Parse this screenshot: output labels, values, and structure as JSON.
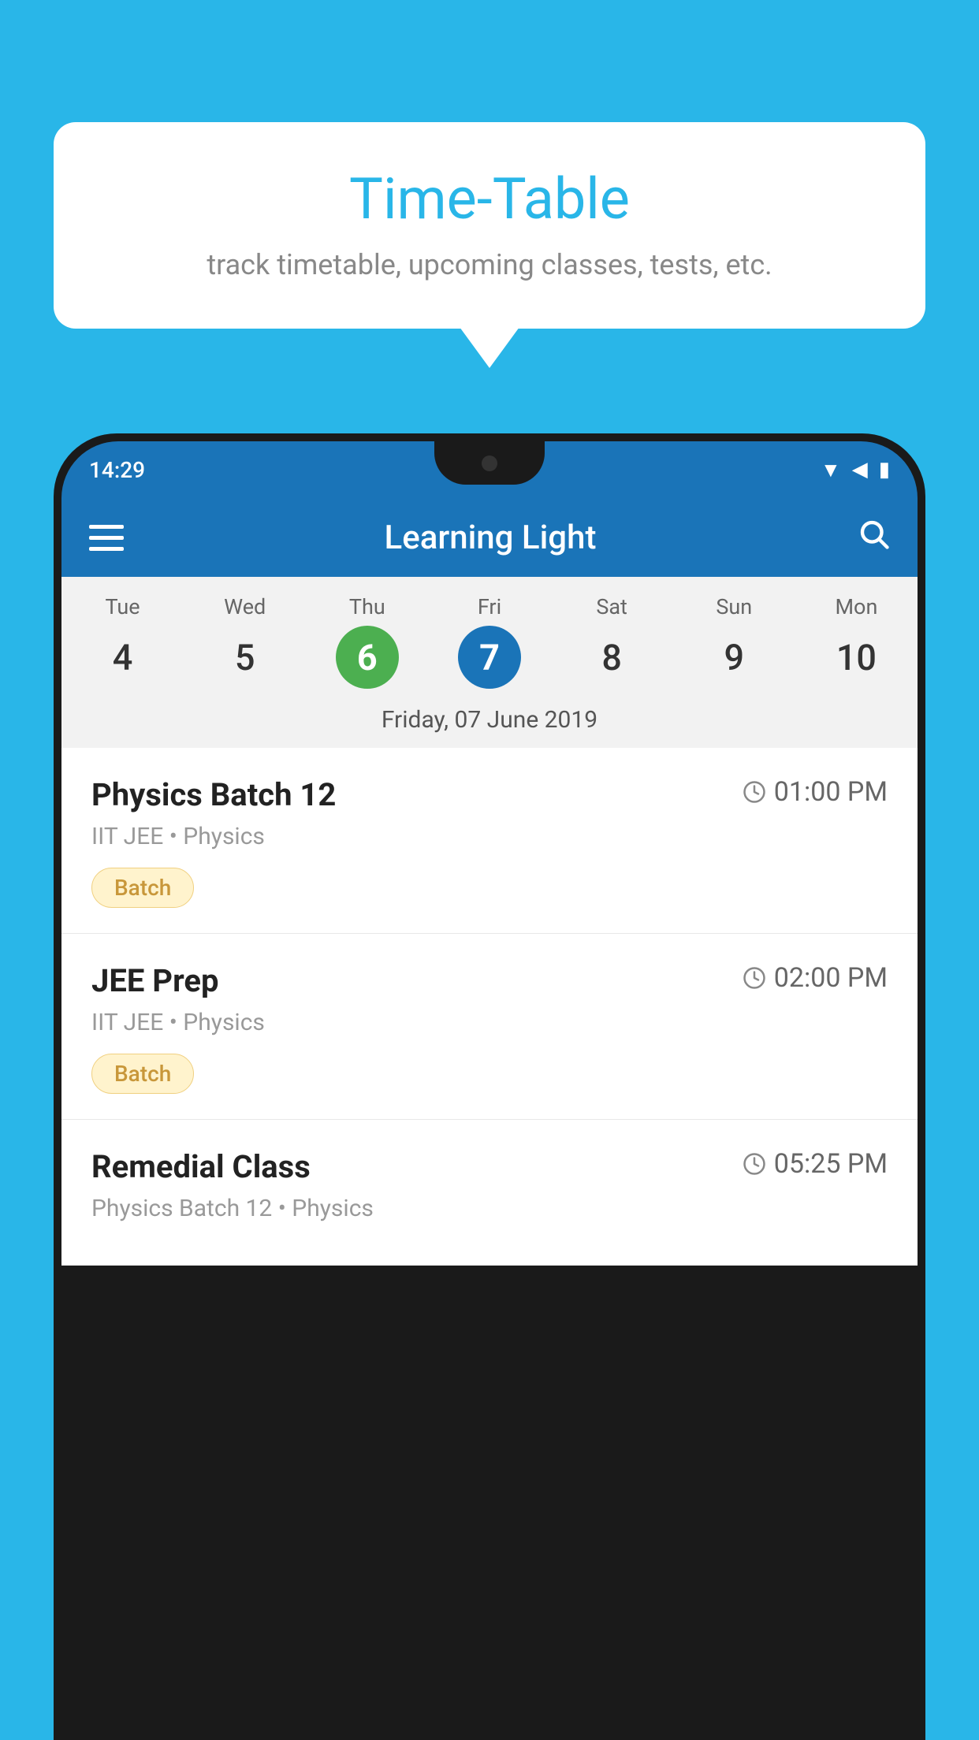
{
  "background_color": "#29B6E8",
  "tooltip": {
    "title": "Time-Table",
    "subtitle": "track timetable, upcoming classes, tests, etc."
  },
  "status_bar": {
    "time": "14:29"
  },
  "app_bar": {
    "title": "Learning Light",
    "search_label": "search"
  },
  "calendar": {
    "days": [
      {
        "name": "Tue",
        "number": "4",
        "state": "normal"
      },
      {
        "name": "Wed",
        "number": "5",
        "state": "normal"
      },
      {
        "name": "Thu",
        "number": "6",
        "state": "today"
      },
      {
        "name": "Fri",
        "number": "7",
        "state": "selected"
      },
      {
        "name": "Sat",
        "number": "8",
        "state": "normal"
      },
      {
        "name": "Sun",
        "number": "9",
        "state": "normal"
      },
      {
        "name": "Mon",
        "number": "10",
        "state": "normal"
      }
    ],
    "selected_date_label": "Friday, 07 June 2019"
  },
  "classes": [
    {
      "name": "Physics Batch 12",
      "time": "01:00 PM",
      "meta": "IIT JEE • Physics",
      "badge": "Batch"
    },
    {
      "name": "JEE Prep",
      "time": "02:00 PM",
      "meta": "IIT JEE • Physics",
      "badge": "Batch"
    },
    {
      "name": "Remedial Class",
      "time": "05:25 PM",
      "meta": "Physics Batch 12 • Physics",
      "badge": ""
    }
  ],
  "labels": {
    "hamburger": "menu",
    "search": "🔍",
    "clock": "🕐"
  }
}
